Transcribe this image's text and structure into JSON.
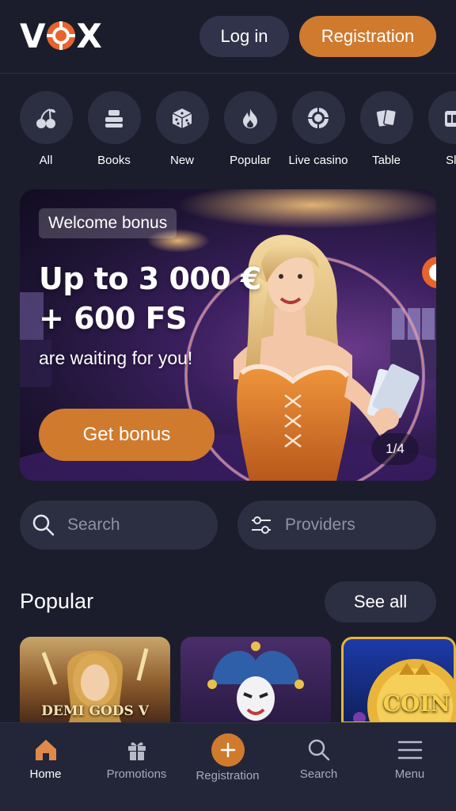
{
  "header": {
    "logo_text_left": "V",
    "logo_text_right": "X",
    "login_label": "Log in",
    "registration_label": "Registration"
  },
  "categories": [
    {
      "label": "All",
      "icon": "cherries-icon"
    },
    {
      "label": "Books",
      "icon": "books-icon"
    },
    {
      "label": "New",
      "icon": "dice-icon"
    },
    {
      "label": "Popular",
      "icon": "flame-icon"
    },
    {
      "label": "Live casino",
      "icon": "chip-icon"
    },
    {
      "label": "Table",
      "icon": "cards-icon"
    },
    {
      "label": "Slo",
      "icon": "slot-icon"
    }
  ],
  "banner": {
    "badge": "Welcome bonus",
    "headline_line1": "Up to 3 000 €",
    "headline_line2": "+ 600 FS",
    "subline": "are waiting for you!",
    "cta": "Get bonus",
    "pager": "1/4"
  },
  "search": {
    "placeholder": "Search",
    "providers_label": "Providers"
  },
  "popular": {
    "title": "Popular",
    "see_all": "See all",
    "games": [
      {
        "name": "DEMI GODS V"
      },
      {
        "name": ""
      },
      {
        "name": "COIN"
      }
    ]
  },
  "bottom_nav": [
    {
      "label": "Home",
      "icon": "home-icon",
      "active": true
    },
    {
      "label": "Promotions",
      "icon": "gift-icon",
      "active": false
    },
    {
      "label": "Registration",
      "icon": "plus-icon",
      "active": false
    },
    {
      "label": "Search",
      "icon": "search-icon",
      "active": false
    },
    {
      "label": "Menu",
      "icon": "menu-icon",
      "active": false
    }
  ],
  "colors": {
    "background": "#1b1d2c",
    "surface": "#2c2f42",
    "accent": "#d07a2e",
    "muted_text": "#8f93a8"
  }
}
